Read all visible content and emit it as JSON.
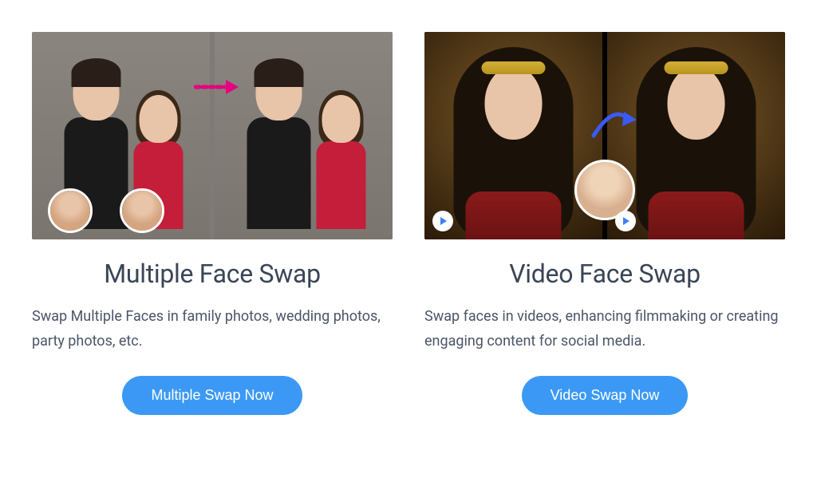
{
  "cards": [
    {
      "title": "Multiple Face Swap",
      "description": "Swap Multiple Faces in family photos, wedding photos, party photos, etc.",
      "button_label": "Multiple Swap Now"
    },
    {
      "title": "Video Face Swap",
      "description": "Swap faces in videos, enhancing filmmaking or creating engaging content for social media.",
      "button_label": "Video Swap Now"
    }
  ],
  "colors": {
    "accent_button": "#3b99f5",
    "title_color": "#3a4556",
    "arrow_pink": "#e6007e",
    "arrow_blue": "#3b5af5"
  }
}
